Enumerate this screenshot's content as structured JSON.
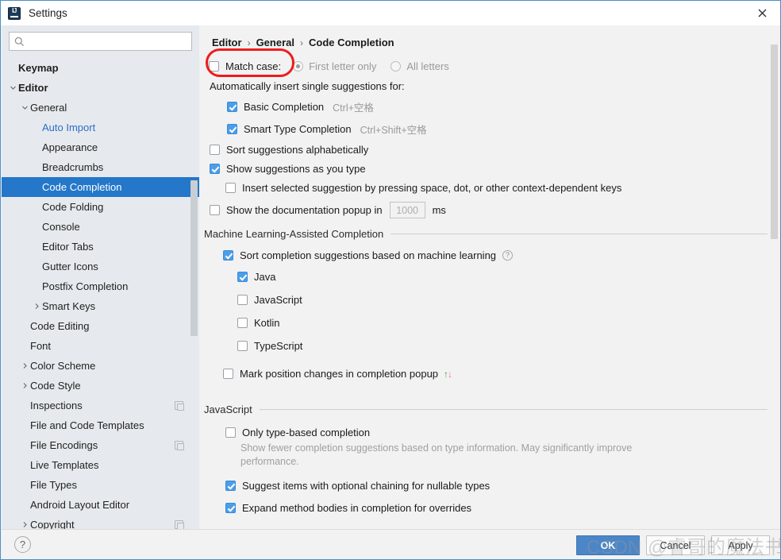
{
  "window": {
    "title": "Settings",
    "app_icon": "intellij-idea-icon",
    "close_icon": "close-icon"
  },
  "sidebar": {
    "search": {
      "value": "",
      "placeholder": "",
      "icon": "search-icon"
    },
    "items": [
      {
        "label": "Keymap",
        "indent": 0,
        "bold": true,
        "arrow": "none",
        "badge": false
      },
      {
        "label": "Editor",
        "indent": 0,
        "bold": true,
        "arrow": "expanded",
        "badge": false
      },
      {
        "label": "General",
        "indent": 1,
        "bold": false,
        "arrow": "expanded",
        "badge": false
      },
      {
        "label": "Auto Import",
        "indent": 2,
        "bold": false,
        "arrow": "none",
        "badge": false,
        "link": true
      },
      {
        "label": "Appearance",
        "indent": 2,
        "bold": false,
        "arrow": "none",
        "badge": false
      },
      {
        "label": "Breadcrumbs",
        "indent": 2,
        "bold": false,
        "arrow": "none",
        "badge": false
      },
      {
        "label": "Code Completion",
        "indent": 2,
        "bold": false,
        "arrow": "none",
        "badge": false,
        "selected": true
      },
      {
        "label": "Code Folding",
        "indent": 2,
        "bold": false,
        "arrow": "none",
        "badge": false
      },
      {
        "label": "Console",
        "indent": 2,
        "bold": false,
        "arrow": "none",
        "badge": false
      },
      {
        "label": "Editor Tabs",
        "indent": 2,
        "bold": false,
        "arrow": "none",
        "badge": false
      },
      {
        "label": "Gutter Icons",
        "indent": 2,
        "bold": false,
        "arrow": "none",
        "badge": false
      },
      {
        "label": "Postfix Completion",
        "indent": 2,
        "bold": false,
        "arrow": "none",
        "badge": false
      },
      {
        "label": "Smart Keys",
        "indent": 2,
        "bold": false,
        "arrow": "collapsed",
        "badge": false
      },
      {
        "label": "Code Editing",
        "indent": 1,
        "bold": false,
        "arrow": "none",
        "badge": false
      },
      {
        "label": "Font",
        "indent": 1,
        "bold": false,
        "arrow": "none",
        "badge": false
      },
      {
        "label": "Color Scheme",
        "indent": 1,
        "bold": false,
        "arrow": "collapsed",
        "badge": false
      },
      {
        "label": "Code Style",
        "indent": 1,
        "bold": false,
        "arrow": "collapsed",
        "badge": false
      },
      {
        "label": "Inspections",
        "indent": 1,
        "bold": false,
        "arrow": "none",
        "badge": true
      },
      {
        "label": "File and Code Templates",
        "indent": 1,
        "bold": false,
        "arrow": "none",
        "badge": false
      },
      {
        "label": "File Encodings",
        "indent": 1,
        "bold": false,
        "arrow": "none",
        "badge": true
      },
      {
        "label": "Live Templates",
        "indent": 1,
        "bold": false,
        "arrow": "none",
        "badge": false
      },
      {
        "label": "File Types",
        "indent": 1,
        "bold": false,
        "arrow": "none",
        "badge": false
      },
      {
        "label": "Android Layout Editor",
        "indent": 1,
        "bold": false,
        "arrow": "none",
        "badge": false
      },
      {
        "label": "Copyright",
        "indent": 1,
        "bold": false,
        "arrow": "collapsed",
        "badge": true
      }
    ]
  },
  "main": {
    "breadcrumb": [
      "Editor",
      "General",
      "Code Completion"
    ],
    "breadcrumb_sep": "›",
    "match_case": {
      "label": "Match case:",
      "checked": false,
      "options": [
        {
          "label": "First letter only",
          "selected": true,
          "disabled": true
        },
        {
          "label": "All letters",
          "selected": false,
          "disabled": true
        }
      ]
    },
    "auto_insert": {
      "label": "Automatically insert single suggestions for:",
      "items": [
        {
          "label": "Basic Completion",
          "checked": true,
          "shortcut": "Ctrl+空格"
        },
        {
          "label": "Smart Type Completion",
          "checked": true,
          "shortcut": "Ctrl+Shift+空格"
        }
      ]
    },
    "options": [
      {
        "label": "Sort suggestions alphabetically",
        "checked": false
      },
      {
        "label": "Show suggestions as you type",
        "checked": true
      },
      {
        "label": "Insert selected suggestion by pressing space, dot, or other context-dependent keys",
        "checked": false
      }
    ],
    "doc_popup": {
      "label": "Show the documentation popup in",
      "checked": false,
      "value": "1000",
      "unit": "ms"
    },
    "ml_section": {
      "title": "Machine Learning-Assisted Completion",
      "sort_option": {
        "label": "Sort completion suggestions based on machine learning",
        "checked": true,
        "help_icon": "help-circle-icon",
        "help_glyph": "?"
      },
      "languages": [
        {
          "label": "Java",
          "checked": true
        },
        {
          "label": "JavaScript",
          "checked": false
        },
        {
          "label": "Kotlin",
          "checked": false
        },
        {
          "label": "TypeScript",
          "checked": false
        }
      ],
      "mark_position": {
        "label": "Mark position changes in completion popup",
        "checked": false,
        "up_glyph": "↑",
        "down_glyph": "↓",
        "up_color": "#4aa14a",
        "down_color": "#e08080"
      }
    },
    "javascript_section": {
      "title": "JavaScript",
      "items": [
        {
          "label": "Only type-based completion",
          "checked": false,
          "description": "Show fewer completion suggestions based on type information. May significantly improve performance."
        },
        {
          "label": "Suggest items with optional chaining for nullable types",
          "checked": true
        },
        {
          "label": "Expand method bodies in completion for overrides",
          "checked": true
        }
      ]
    }
  },
  "footer": {
    "help_glyph": "?",
    "ok": "OK",
    "cancel": "Cancel",
    "apply": "Apply"
  },
  "annotation": {
    "shape": "red-oval-highlight",
    "color": "#ee1c1c",
    "target": "Match case:"
  },
  "watermark": {
    "text": "CSDN @睿哥的魔法书"
  },
  "colors": {
    "selection": "#2477c9",
    "accent_link": "#2b6fc4",
    "checkbox_checked": "#4a9eea",
    "ok_button": "#4a86c8",
    "sidebar_bg": "#e6eaee",
    "main_bg": "#f2f2f2"
  }
}
